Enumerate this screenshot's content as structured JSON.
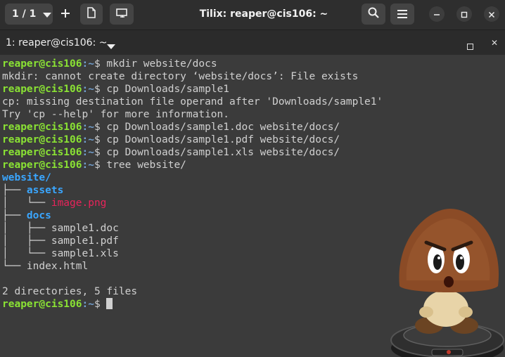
{
  "header": {
    "sessions_label": "1 / 1",
    "title": "Tilix: reaper@cis106: ~",
    "icons": {
      "sessions_caret": "chevron-down-icon",
      "add": "plus-icon",
      "new_window": "new-window-icon",
      "sync": "sync-input-icon",
      "search": "search-icon",
      "menu": "hamburger-menu-icon",
      "minimize": "minimize-icon",
      "maximize": "maximize-icon",
      "close": "close-icon"
    }
  },
  "terminal_bar": {
    "title": "1: reaper@cis106: ~",
    "close_glyph": "✕"
  },
  "colors": {
    "user": "#8ae234",
    "path": "#729fcf",
    "directory": "#3aa6ff",
    "image_file": "#e8235a",
    "text": "#d0d0d0",
    "background": "#3b3b3b"
  },
  "lines": [
    {
      "type": "prompt",
      "user": "reaper@cis106",
      "path": ":~",
      "cmd": "$ mkdir website/docs"
    },
    {
      "type": "output",
      "text": "mkdir: cannot create directory ‘website/docs’: File exists"
    },
    {
      "type": "prompt",
      "user": "reaper@cis106",
      "path": ":~",
      "cmd": "$ cp Downloads/sample1"
    },
    {
      "type": "output",
      "text": "cp: missing destination file operand after 'Downloads/sample1'"
    },
    {
      "type": "output",
      "text": "Try 'cp --help' for more information."
    },
    {
      "type": "prompt",
      "user": "reaper@cis106",
      "path": ":~",
      "cmd": "$ cp Downloads/sample1.doc website/docs/"
    },
    {
      "type": "prompt",
      "user": "reaper@cis106",
      "path": ":~",
      "cmd": "$ cp Downloads/sample1.pdf website/docs/"
    },
    {
      "type": "prompt",
      "user": "reaper@cis106",
      "path": ":~",
      "cmd": "$ cp Downloads/sample1.xls website/docs/"
    },
    {
      "type": "prompt",
      "user": "reaper@cis106",
      "path": ":~",
      "cmd": "$ tree website/"
    },
    {
      "type": "tree",
      "prefix": "",
      "name": "website/",
      "kind": "dir"
    },
    {
      "type": "tree",
      "prefix": "├── ",
      "name": "assets",
      "kind": "dir"
    },
    {
      "type": "tree",
      "prefix": "│   └── ",
      "name": "image.png",
      "kind": "img"
    },
    {
      "type": "tree",
      "prefix": "├── ",
      "name": "docs",
      "kind": "dir"
    },
    {
      "type": "tree",
      "prefix": "│   ├── ",
      "name": "sample1.doc",
      "kind": "file"
    },
    {
      "type": "tree",
      "prefix": "│   ├── ",
      "name": "sample1.pdf",
      "kind": "file"
    },
    {
      "type": "tree",
      "prefix": "│   └── ",
      "name": "sample1.xls",
      "kind": "file"
    },
    {
      "type": "tree",
      "prefix": "└── ",
      "name": "index.html",
      "kind": "file"
    },
    {
      "type": "blank"
    },
    {
      "type": "output",
      "text": "2 directories, 5 files"
    },
    {
      "type": "prompt",
      "user": "reaper@cis106",
      "path": ":~",
      "cmd": "$ ",
      "cursor": true
    }
  ]
}
